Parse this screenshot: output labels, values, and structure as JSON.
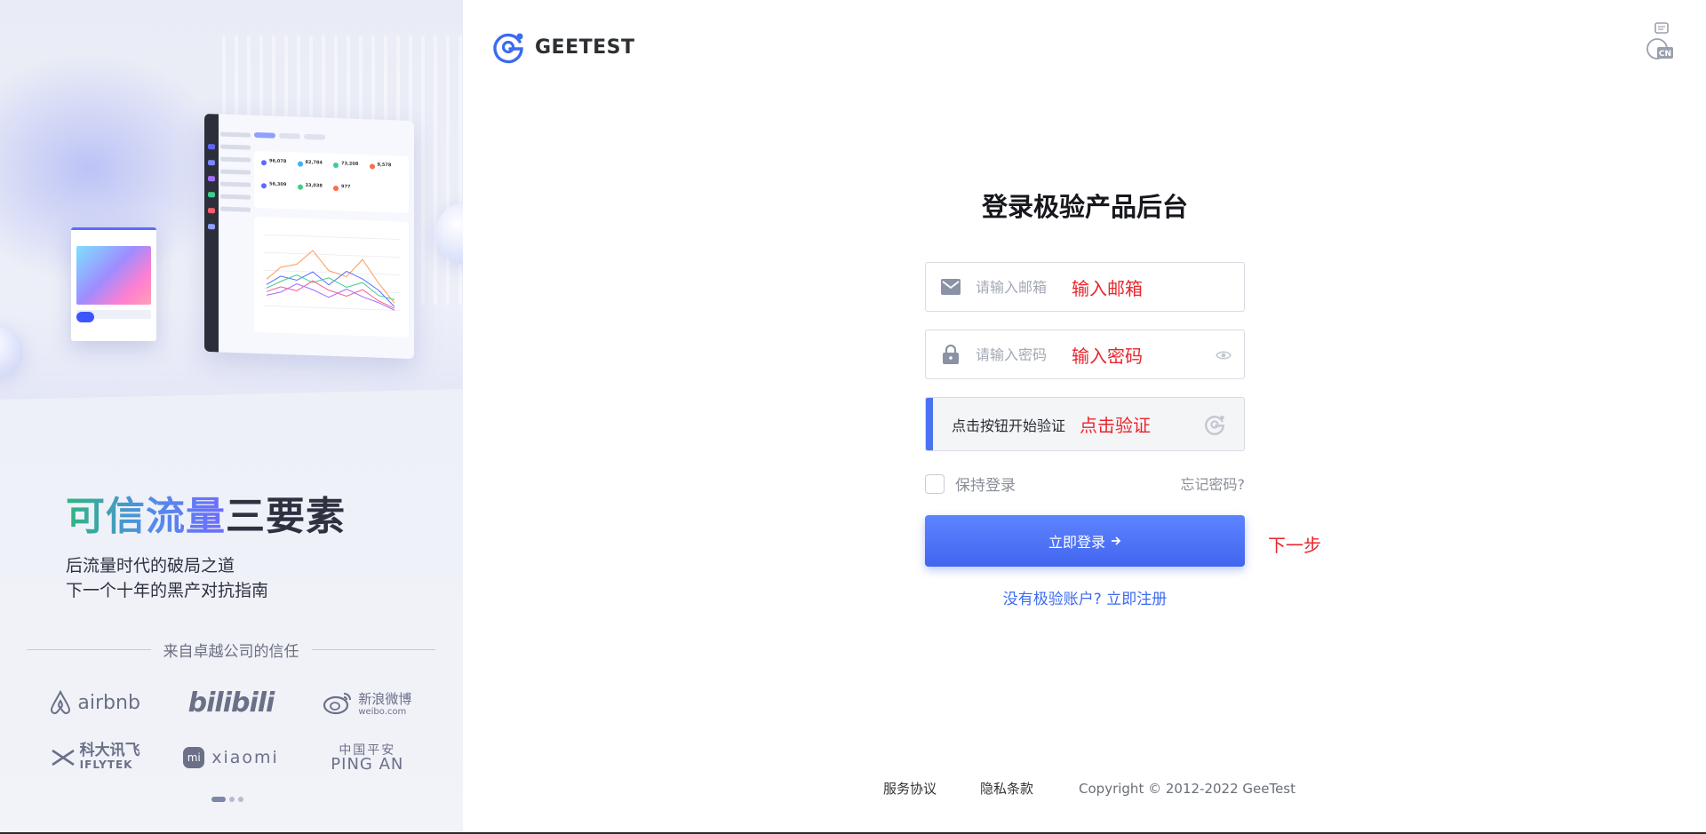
{
  "brand": {
    "name": "GEETEST",
    "accent": "#3d6bef"
  },
  "left": {
    "slogan_gradient": "可信流量",
    "slogan_dark": "三要素",
    "subtitle_line1": "后流量时代的破局之道",
    "subtitle_line2": "下一个十年的黑产对抗指南",
    "trust_title": "来自卓越公司的信任",
    "logos": {
      "airbnb": "airbnb",
      "bilibili": "bilibili",
      "weibo_cn": "新浪微博",
      "weibo_en": "weibo.com",
      "iflytek_cn": "科大讯飞",
      "iflytek_en": "IFLYTEK",
      "xiaomi_mark": "mi",
      "xiaomi": "xiaomi",
      "pingan_cn": "中国平安",
      "pingan_en": "PING AN"
    }
  },
  "lang": {
    "label": "CN"
  },
  "form": {
    "title": "登录极验产品后台",
    "email_placeholder": "请输入邮箱",
    "email_note": "输入邮箱",
    "password_placeholder": "请输入密码",
    "password_note": "输入密码",
    "verify_label": "点击按钮开始验证",
    "verify_note": "点击验证",
    "remember_label": "保持登录",
    "forgot_label": "忘记密码?",
    "login_label": "立即登录",
    "next_note": "下一步",
    "register_label": "没有极验账户? 立即注册"
  },
  "footer": {
    "terms": "服务协议",
    "privacy": "隐私条款",
    "copyright": "Copyright © 2012-2022 GeeTest"
  },
  "colors": {
    "annotation": "#e8262c",
    "primary": "#4b72f2",
    "verify_bar": "#4b72f2"
  }
}
